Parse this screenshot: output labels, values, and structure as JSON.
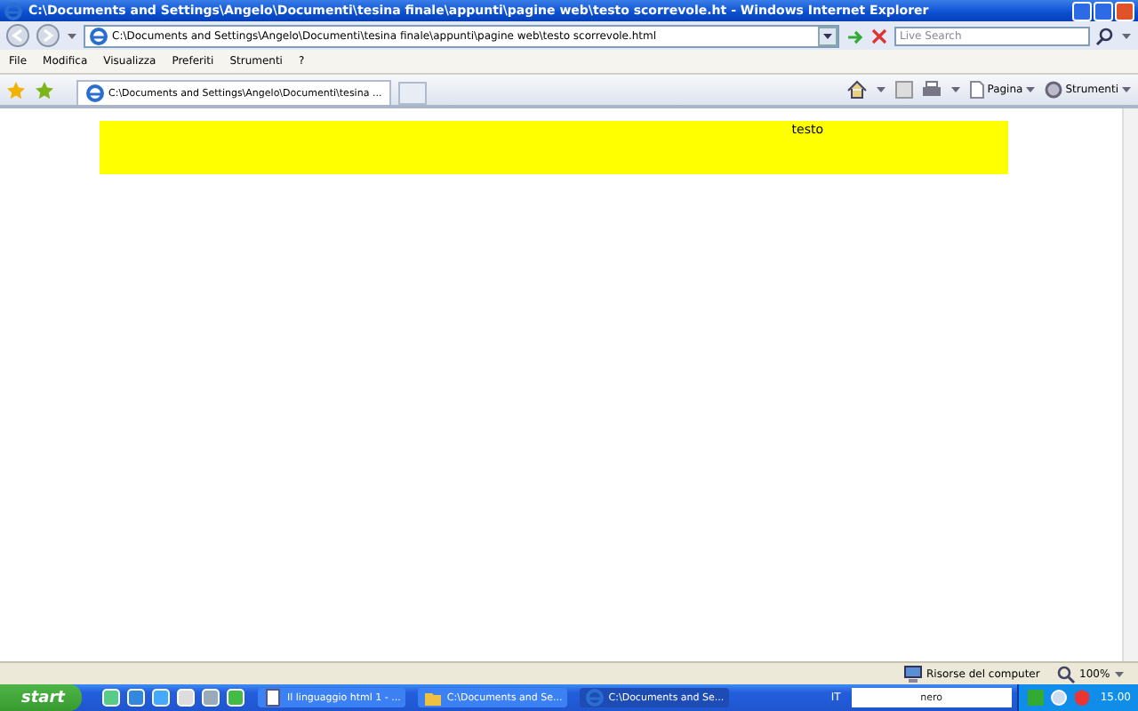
{
  "window": {
    "title": "C:\\Documents and Settings\\Angelo\\Documenti\\tesina finale\\appunti\\pagine web\\testo scorrevole.ht - Windows Internet Explorer"
  },
  "address": {
    "value": "C:\\Documents and Settings\\Angelo\\Documenti\\tesina finale\\appunti\\pagine web\\testo scorrevole.html"
  },
  "search": {
    "placeholder": "Live Search"
  },
  "menu": [
    "File",
    "Modifica",
    "Visualizza",
    "Preferiti",
    "Strumenti",
    "?"
  ],
  "tabs": [
    {
      "label": "C:\\Documents and Settings\\Angelo\\Documenti\\tesina ...",
      "selected": true
    }
  ],
  "toolbar": [
    "Pagina",
    "Strumenti"
  ],
  "page": {
    "marquee": "testo"
  },
  "status_bar": {
    "zone": "Risorse del computer",
    "zoom": "100%"
  },
  "taskbar": {
    "start": "start",
    "tasks": [
      {
        "label": "Il linguaggio html 1 - ...",
        "kind": "doc",
        "selected": false
      },
      {
        "label": "C:\\Documents and Se...",
        "kind": "folder",
        "selected": false
      },
      {
        "label": "C:\\Documents and Se...",
        "kind": "ie",
        "selected": true
      }
    ],
    "language": "IT",
    "nero": "nero",
    "clock": "15.00"
  }
}
